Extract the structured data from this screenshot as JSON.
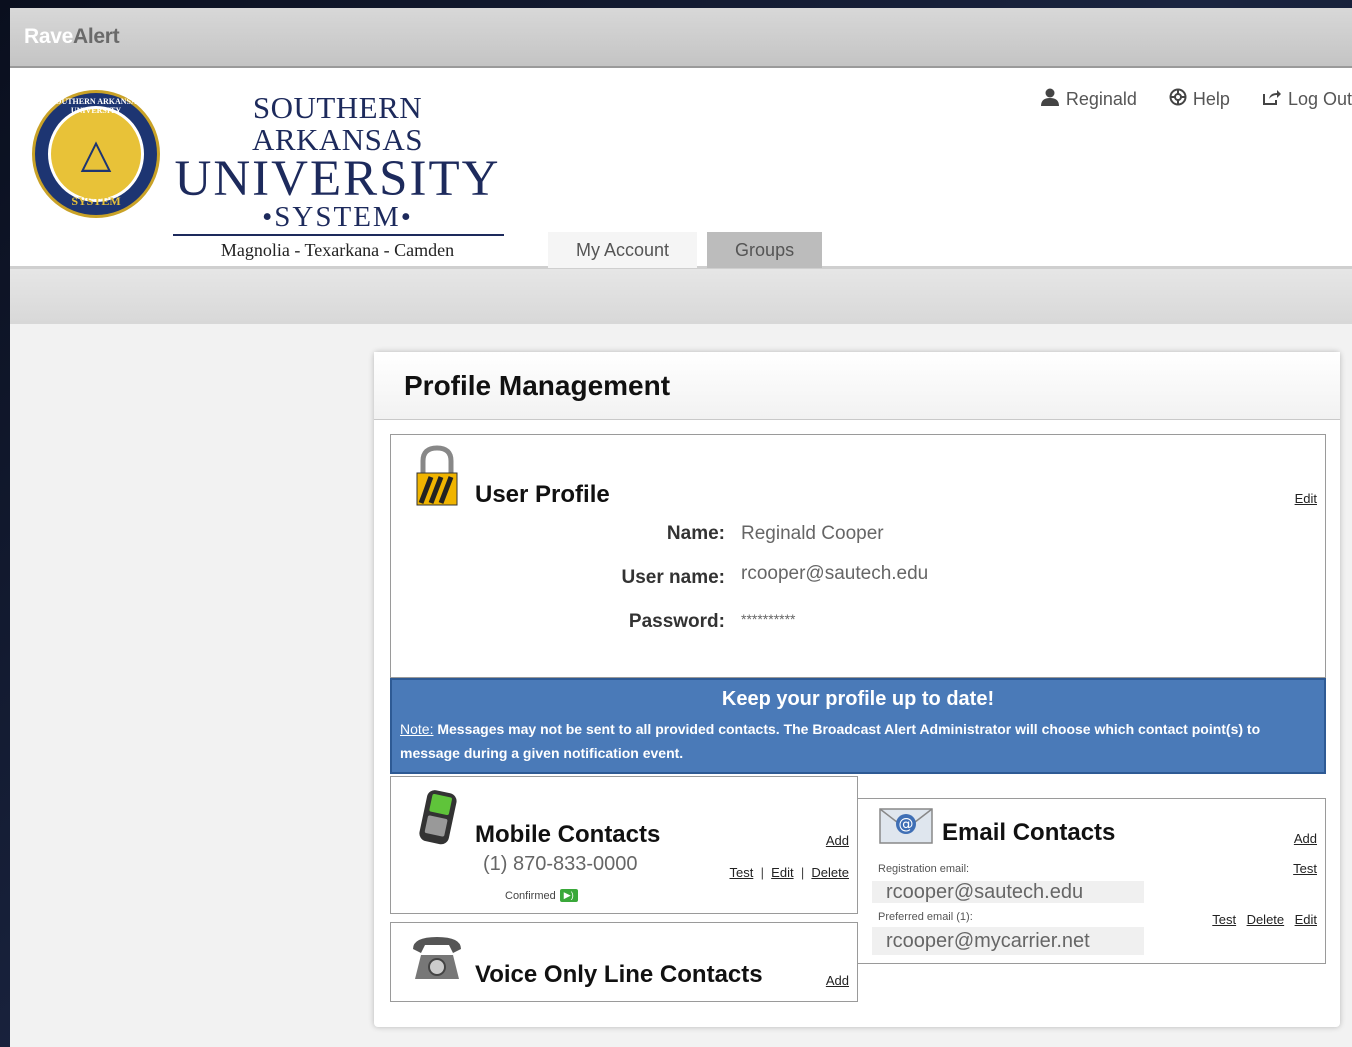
{
  "app": {
    "brand_rave": "Rave",
    "brand_alert": "Alert"
  },
  "logo": {
    "seal_ring": "SOUTHERN ARKANSAS UNIVERSITY",
    "seal_bottom": "SYSTEM",
    "line1": "SOUTHERN ARKANSAS",
    "line2": "UNIVERSITY",
    "line3": "•SYSTEM•",
    "line4": "Magnolia  -  Texarkana  -  Camden"
  },
  "topnav": {
    "user": "Reginald",
    "help": "Help",
    "logout": "Log Out"
  },
  "tabs": [
    {
      "label": "My Account"
    },
    {
      "label": "Groups"
    }
  ],
  "panel": {
    "title": "Profile Management"
  },
  "user_profile": {
    "title": "User Profile",
    "edit": "Edit",
    "fields": [
      {
        "label": "Name:",
        "value": "Reginald Cooper"
      },
      {
        "label": "User name:",
        "value": "rcooper@sautech.edu"
      },
      {
        "label": "Password:",
        "value": "**********"
      }
    ]
  },
  "note": {
    "heading": "Keep your profile up to date!",
    "prefix": "Note:",
    "text": " Messages may not be sent to all provided contacts. The Broadcast Alert Administrator will choose which contact point(s) to message during a given notification event."
  },
  "mobile": {
    "title": "Mobile Contacts",
    "add": "Add",
    "number": "(1) 870-833-0000",
    "test": "Test",
    "edit": "Edit",
    "delete": "Delete",
    "status": "Confirmed"
  },
  "voice": {
    "title": "Voice Only Line Contacts",
    "add": "Add"
  },
  "email": {
    "title": "Email Contacts",
    "add": "Add",
    "registration_label": "Registration email:",
    "registration_value": "rcooper@sautech.edu",
    "registration_test": "Test",
    "preferred_label": "Preferred email (1):",
    "preferred_value": "rcooper@mycarrier.net",
    "test": "Test",
    "delete": "Delete",
    "edit": "Edit"
  },
  "colors": {
    "note_bg": "#4a7ab8",
    "logo_navy": "#1d2a5c",
    "logo_gold": "#e8c238"
  }
}
